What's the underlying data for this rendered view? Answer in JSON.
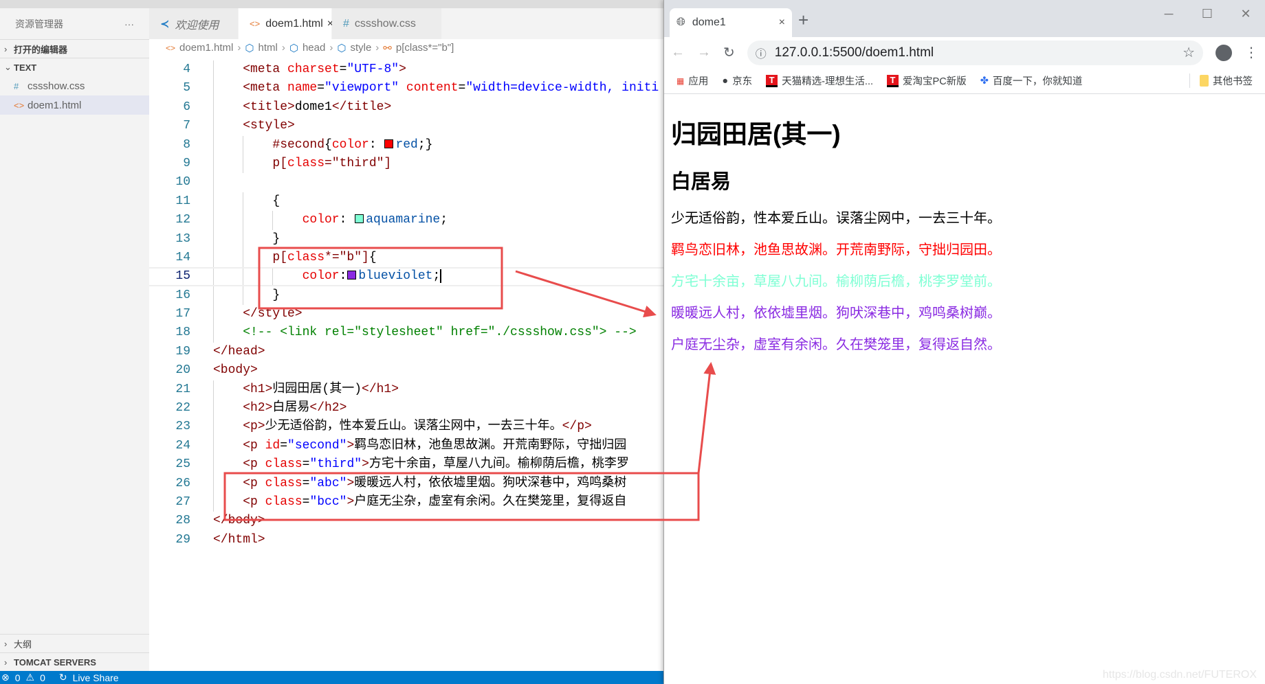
{
  "sidebar": {
    "title": "资源管理器",
    "more": "···",
    "open_editors": "打开的编辑器",
    "folder": "TEXT",
    "files": [
      {
        "icon": "#",
        "name": "cssshow.css"
      },
      {
        "icon": "<>",
        "name": "doem1.html"
      }
    ],
    "outline": "大纲",
    "tomcat": "TOMCAT SERVERS"
  },
  "tabs": [
    {
      "label": "欢迎使用"
    },
    {
      "label": "doem1.html",
      "close": "×"
    },
    {
      "label": "cssshow.css"
    }
  ],
  "breadcrumb": [
    "doem1.html",
    "html",
    "head",
    "style",
    "p[class*=\"b\"]"
  ],
  "status": {
    "errors": "0",
    "warnings": "0",
    "live_share": "Live Share"
  },
  "colors": {
    "accent": "#007acc",
    "red": "#ff0000",
    "aquamarine": "#7fffd4",
    "blueviolet": "#8a2be2",
    "annotation": "#e84c4c"
  },
  "code": [
    {
      "n": "4",
      "i": 1,
      "t": [
        [
          "<meta",
          "tag"
        ],
        [
          " ",
          "p"
        ],
        [
          "charset",
          "attr"
        ],
        [
          "=",
          "p"
        ],
        [
          "\"UTF-8\"",
          "str"
        ],
        [
          ">",
          "tag"
        ]
      ]
    },
    {
      "n": "5",
      "i": 1,
      "t": [
        [
          "<meta",
          "tag"
        ],
        [
          " ",
          "p"
        ],
        [
          "name",
          "attr"
        ],
        [
          "=",
          "p"
        ],
        [
          "\"viewport\"",
          "str"
        ],
        [
          " ",
          "p"
        ],
        [
          "content",
          "attr"
        ],
        [
          "=",
          "p"
        ],
        [
          "\"width=device-width, initi",
          "str"
        ]
      ]
    },
    {
      "n": "6",
      "i": 1,
      "t": [
        [
          "<title>",
          "tag"
        ],
        [
          "dome1",
          "txt"
        ],
        [
          "</title>",
          "tag"
        ]
      ]
    },
    {
      "n": "7",
      "i": 1,
      "t": [
        [
          "<style>",
          "tag"
        ]
      ]
    },
    {
      "n": "8",
      "i": 2,
      "t": [
        [
          "#second",
          "sel"
        ],
        [
          "{",
          "p"
        ],
        [
          "color",
          "prop"
        ],
        [
          ": ",
          "p"
        ],
        [
          "#ff0000",
          "swatch"
        ],
        [
          "red",
          "val"
        ],
        [
          ";}",
          "p"
        ]
      ]
    },
    {
      "n": "9",
      "i": 2,
      "t": [
        [
          "p[",
          "sel"
        ],
        [
          "class",
          "attr"
        ],
        [
          "=\"third\"]",
          "sel"
        ]
      ]
    },
    {
      "n": "10",
      "i": 2,
      "t": []
    },
    {
      "n": "11",
      "i": 2,
      "t": [
        [
          "{",
          "p"
        ]
      ]
    },
    {
      "n": "12",
      "i": 3,
      "t": [
        [
          "color",
          "prop"
        ],
        [
          ": ",
          "p"
        ],
        [
          "#7fffd4",
          "swatch"
        ],
        [
          "aquamarine",
          "val"
        ],
        [
          ";",
          "p"
        ]
      ]
    },
    {
      "n": "13",
      "i": 2,
      "t": [
        [
          "}",
          "p"
        ]
      ]
    },
    {
      "n": "14",
      "i": 2,
      "t": [
        [
          "p[",
          "sel"
        ],
        [
          "class",
          "attr"
        ],
        [
          "*=\"b\"]",
          "sel"
        ],
        [
          "{",
          "p"
        ]
      ]
    },
    {
      "n": "15",
      "i": 3,
      "cur": true,
      "t": [
        [
          "color",
          "prop"
        ],
        [
          ":",
          "p"
        ],
        [
          "#8a2be2",
          "swatch"
        ],
        [
          "blueviolet",
          "val"
        ],
        [
          ";",
          "p"
        ]
      ]
    },
    {
      "n": "16",
      "i": 2,
      "t": [
        [
          "}",
          "p"
        ]
      ]
    },
    {
      "n": "17",
      "i": 1,
      "t": [
        [
          "</style>",
          "tag"
        ]
      ]
    },
    {
      "n": "18",
      "i": 1,
      "t": [
        [
          "<!-- <link rel=\"stylesheet\" href=\"./cssshow.css\"> -->",
          "com"
        ]
      ]
    },
    {
      "n": "19",
      "i": 0,
      "t": [
        [
          "</head>",
          "tag"
        ]
      ]
    },
    {
      "n": "20",
      "i": 0,
      "t": [
        [
          "<body>",
          "tag"
        ]
      ]
    },
    {
      "n": "21",
      "i": 1,
      "t": [
        [
          "<h1>",
          "tag"
        ],
        [
          "归园田居(其一)",
          "txt"
        ],
        [
          "</h1>",
          "tag"
        ]
      ]
    },
    {
      "n": "22",
      "i": 1,
      "t": [
        [
          "<h2>",
          "tag"
        ],
        [
          "白居易",
          "txt"
        ],
        [
          "</h2>",
          "tag"
        ]
      ]
    },
    {
      "n": "23",
      "i": 1,
      "t": [
        [
          "<p>",
          "tag"
        ],
        [
          "少无适俗韵，性本爱丘山。误落尘网中，一去三十年。",
          "txt"
        ],
        [
          "</p>",
          "tag"
        ]
      ]
    },
    {
      "n": "24",
      "i": 1,
      "t": [
        [
          "<p",
          "tag"
        ],
        [
          " ",
          "p"
        ],
        [
          "id",
          "attr"
        ],
        [
          "=",
          "p"
        ],
        [
          "\"second\"",
          "str"
        ],
        [
          ">",
          "tag"
        ],
        [
          "羁鸟恋旧林，池鱼思故渊。开荒南野际，守拙归园",
          "txt"
        ]
      ]
    },
    {
      "n": "25",
      "i": 1,
      "t": [
        [
          "<p",
          "tag"
        ],
        [
          " ",
          "p"
        ],
        [
          "class",
          "attr"
        ],
        [
          "=",
          "p"
        ],
        [
          "\"third\"",
          "str"
        ],
        [
          ">",
          "tag"
        ],
        [
          "方宅十余亩，草屋八九间。榆柳荫后檐，桃李罗",
          "txt"
        ]
      ]
    },
    {
      "n": "26",
      "i": 1,
      "t": [
        [
          "<p",
          "tag"
        ],
        [
          " ",
          "p"
        ],
        [
          "class",
          "attr"
        ],
        [
          "=",
          "p"
        ],
        [
          "\"abc\"",
          "str"
        ],
        [
          ">",
          "tag"
        ],
        [
          "暖暖远人村，依依墟里烟。狗吠深巷中，鸡鸣桑树",
          "txt"
        ]
      ]
    },
    {
      "n": "27",
      "i": 1,
      "t": [
        [
          "<p",
          "tag"
        ],
        [
          " ",
          "p"
        ],
        [
          "class",
          "attr"
        ],
        [
          "=",
          "p"
        ],
        [
          "\"bcc\"",
          "str"
        ],
        [
          ">",
          "tag"
        ],
        [
          "户庭无尘杂，虚室有余闲。久在樊笼里，复得返自",
          "txt"
        ]
      ]
    },
    {
      "n": "28",
      "i": 0,
      "t": [
        [
          "</body>",
          "tag"
        ]
      ]
    },
    {
      "n": "29",
      "i": 0,
      "t": [
        [
          "</html>",
          "tag"
        ]
      ]
    }
  ],
  "browser": {
    "tab_title": "dome1",
    "tab_close": "×",
    "new_tab": "+",
    "url": "127.0.0.1:5500/doem1.html",
    "bookmarks": [
      "应用",
      "京东",
      "天猫精选-理想生活...",
      "爱淘宝PC新版",
      "百度一下，你就知道"
    ],
    "other_bookmarks": "其他书签",
    "page": {
      "h1": "归园田居(其一)",
      "h2": "白居易",
      "paragraphs": [
        {
          "text": "少无适俗韵，性本爱丘山。误落尘网中，一去三十年。",
          "color": "#000000"
        },
        {
          "text": "羁鸟恋旧林，池鱼思故渊。开荒南野际，守拙归园田。",
          "color": "#ff0000"
        },
        {
          "text": "方宅十余亩，草屋八九间。榆柳荫后檐，桃李罗堂前。",
          "color": "#7fffd4"
        },
        {
          "text": "暖暖远人村，依依墟里烟。狗吠深巷中，鸡鸣桑树巅。",
          "color": "#8a2be2"
        },
        {
          "text": "户庭无尘杂，虚室有余闲。久在樊笼里，复得返自然。",
          "color": "#8a2be2"
        }
      ]
    },
    "watermark": "https://blog.csdn.net/FUTEROX"
  }
}
